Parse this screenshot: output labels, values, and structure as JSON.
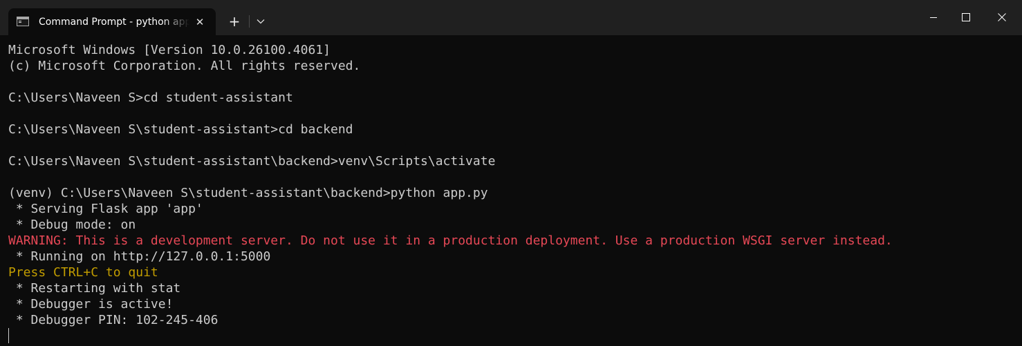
{
  "window": {
    "tab_title": "Command Prompt - python app.py",
    "icons": {
      "tab": "cmd-icon",
      "close_tab": "close-icon",
      "new_tab": "plus-icon",
      "dropdown": "chevron-down-icon",
      "minimize": "minimize-icon",
      "maximize": "maximize-icon",
      "close_window": "close-icon"
    },
    "glyphs": {
      "close_tab": "✕",
      "new_tab": "+"
    }
  },
  "colors": {
    "background": "#0c0c0c",
    "titlebar": "#202020",
    "text": "#cccccc",
    "warning": "#e74856",
    "quit_hint": "#c19c00"
  },
  "console": {
    "lines": [
      "Microsoft Windows [Version 10.0.26100.4061]",
      "(c) Microsoft Corporation. All rights reserved.",
      "",
      "C:\\Users\\Naveen S>cd student-assistant",
      "",
      "C:\\Users\\Naveen S\\student-assistant>cd backend",
      "",
      "C:\\Users\\Naveen S\\student-assistant\\backend>venv\\Scripts\\activate",
      "",
      "(venv) C:\\Users\\Naveen S\\student-assistant\\backend>python app.py",
      " * Serving Flask app 'app'",
      " * Debug mode: on",
      "WARNING: This is a development server. Do not use it in a production deployment. Use a production WSGI server instead.",
      " * Running on http://127.0.0.1:5000",
      "Press CTRL+C to quit",
      " * Restarting with stat",
      " * Debugger is active!",
      " * Debugger PIN: 102-245-406"
    ]
  }
}
